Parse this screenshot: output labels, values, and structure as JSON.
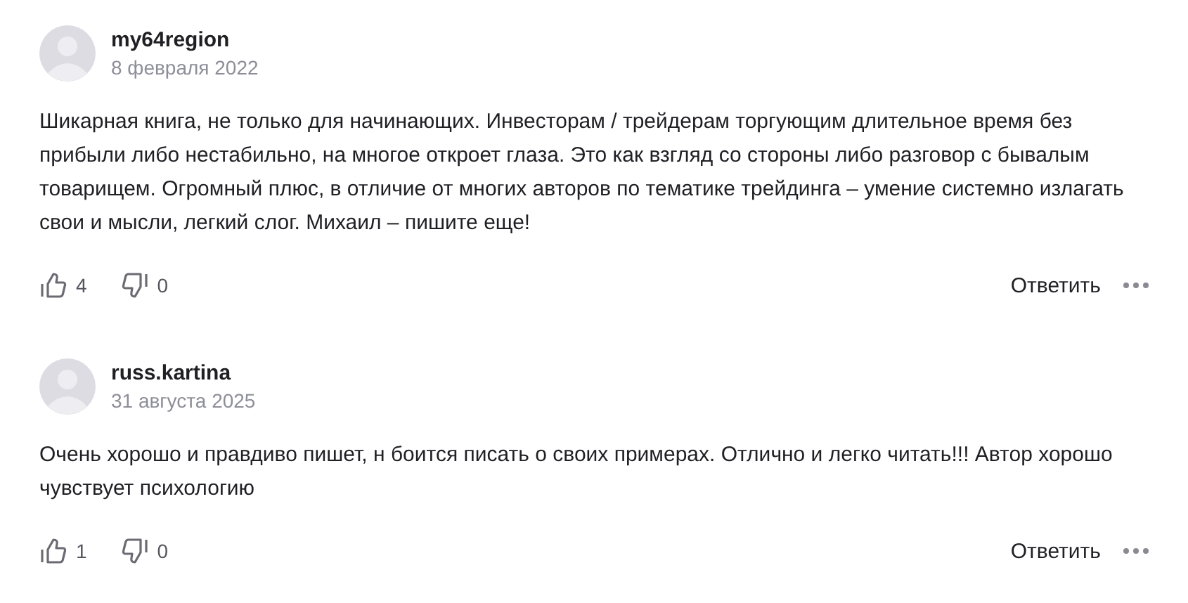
{
  "comments": [
    {
      "author": "my64region",
      "date": "8 февраля 2022",
      "text": "Шикарная книга, не только для начинающих. Инвесторам / трейдерам торгующим длительное время без прибыли либо нестабильно, на многое откроет глаза. Это как взгляд со стороны либо разговор с бывалым товарищем. Огромный плюс, в отличие от многих авторов по тематике трейдинга – умение системно излагать свои и мысли, легкий слог. Михаил – пишите еще!",
      "likes": "4",
      "dislikes": "0",
      "reply": "Ответить"
    },
    {
      "author": "russ.kartina",
      "date": "31 августа 2025",
      "text": "Очень хорошо и правдиво пишет, н боится писать о своих примерах. Отлично и легко читать!!! Автор хорошо чувствует психологию",
      "likes": "1",
      "dislikes": "0",
      "reply": "Ответить"
    }
  ]
}
